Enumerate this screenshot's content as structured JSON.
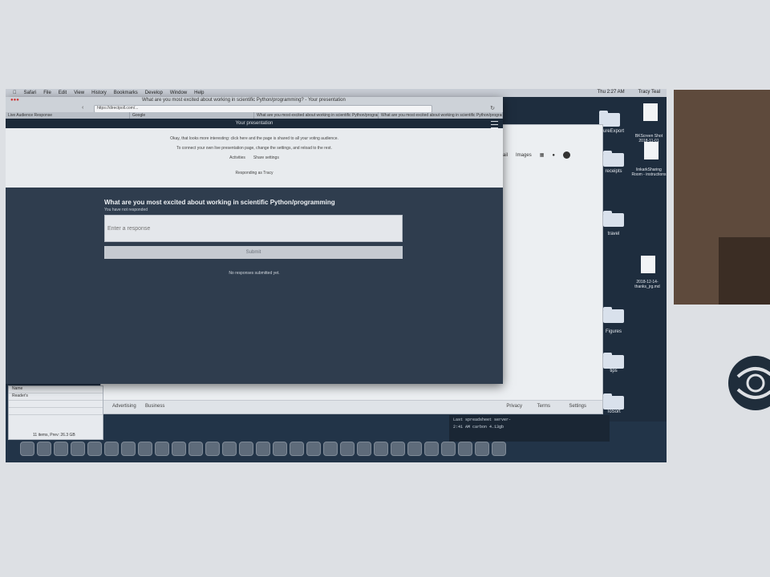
{
  "menubar": {
    "app_items": [
      "Safari",
      "File",
      "Edit",
      "View",
      "History",
      "Bookmarks",
      "Develop",
      "Window",
      "Help"
    ],
    "clock": "Thu 2:27 AM",
    "user": "Tracy Teal"
  },
  "browser": {
    "title": "What are you most excited about working in scientific Python/programming? - Your presentation",
    "url": "https://directpoll.com/...",
    "tabs": [
      "Live Audience Response",
      "Google",
      "What are you most excited about working in scientific Python/programming",
      "What are you most excited about working in scientific Python/programming"
    ]
  },
  "app": {
    "header_title": "Your presentation",
    "info_line1": "Okay, that looks more interesting: click here and the page is shared to all your voting audience.",
    "info_line2": "To connect your own live presentation page, change the settings, and reload to the rest.",
    "info_links": [
      "Activities",
      "Share settings"
    ],
    "responding_to": "Responding as Tracy",
    "question": "What are you most excited about working in scientific Python/programming",
    "not_responded": "You have not responded",
    "response_placeholder": "Enter a response",
    "submit_label": "Submit",
    "no_responses": "No responses submitted yet."
  },
  "google_window": {
    "links": [
      "Gmail",
      "Images"
    ],
    "footer_left": [
      "Advertising",
      "Business"
    ],
    "footer_right": [
      "Privacy",
      "Terms",
      "Settings"
    ]
  },
  "desktop": {
    "items": [
      "PictureExport",
      "receipts",
      "travel",
      "Figures",
      "tips",
      "ToSort",
      "BKScreen Shot 2018-11-01",
      "linkarkSharing Room - instructions",
      "2018-12-14-thanks_jrg.md"
    ]
  },
  "terminal": {
    "lines": [
      "Last   spreadsheet   server-",
      "2:41 AM   carbon 4.13gb"
    ]
  },
  "behind_window": {
    "rows": [
      "Name",
      "Reader's",
      "",
      ""
    ],
    "footer": "11 items, Prev: 26.3 GB"
  },
  "colors": {
    "screen_bg": "#223448",
    "app_header": "#1c2a39",
    "question_bg": "#2f3d4e",
    "input_bg": "#e4e7eb"
  }
}
